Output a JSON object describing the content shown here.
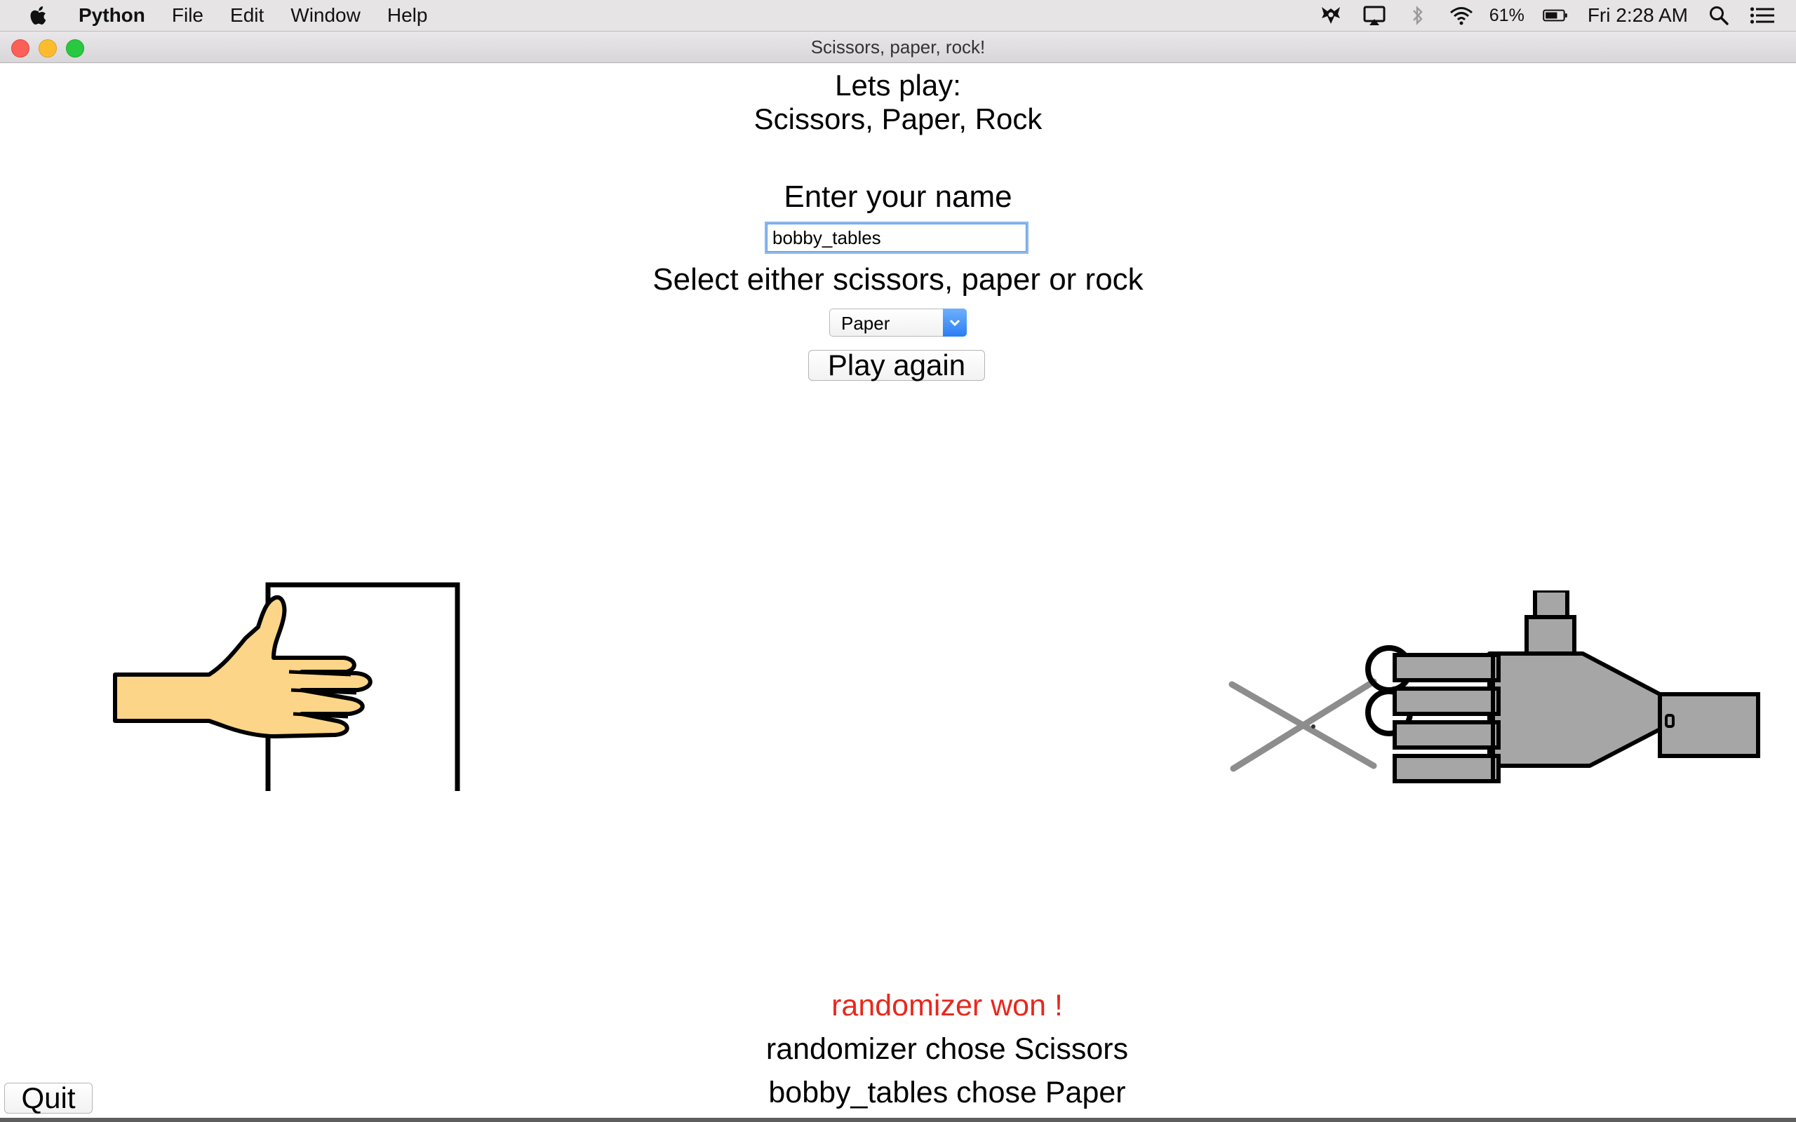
{
  "menubar": {
    "app_name": "Python",
    "menus": [
      "File",
      "Edit",
      "Window",
      "Help"
    ],
    "battery_percent": "61%",
    "clock": "Fri 2:28 AM",
    "icons": [
      "apple-icon",
      "app-tray-icon",
      "airplay-icon",
      "bluetooth-icon",
      "wifi-icon",
      "battery-icon",
      "spotlight-icon",
      "notification-center-icon"
    ]
  },
  "window": {
    "title": "Scissors, paper, rock!"
  },
  "game": {
    "heading_line1": "Lets play:",
    "heading_line2": "Scissors, Paper, Rock",
    "name_label": "Enter your name",
    "name_value": "bobby_tables",
    "select_label": "Select either scissors, paper or rock",
    "selected_choice": "Paper",
    "play_button": "Play again",
    "player_hand_image": "paper-hand",
    "computer_hand_image": "scissors-robot-hand",
    "result_winner": "randomizer won !",
    "result_computer": "randomizer chose Scissors",
    "result_player": "bobby_tables chose Paper",
    "quit_button": "Quit"
  },
  "colors": {
    "winner_text": "#e8281e",
    "hand_skin": "#fdd588",
    "robot_gray": "#a6a6a6",
    "focus_ring": "#8bb8ee",
    "select_arrow": "#2a7ef4"
  }
}
